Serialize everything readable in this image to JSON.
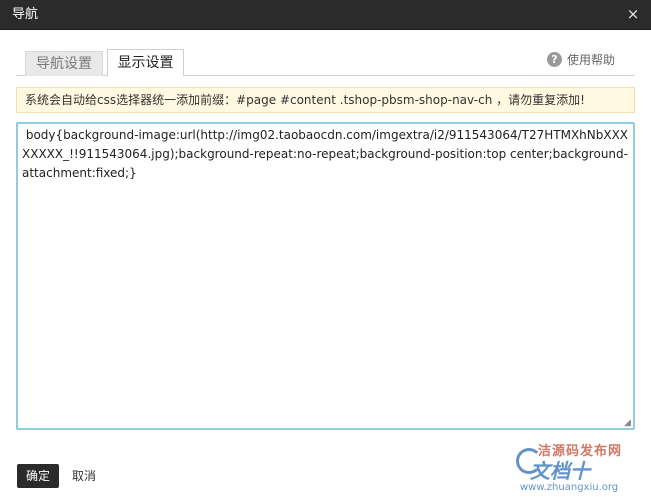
{
  "dialog": {
    "title": "导航",
    "close_glyph": "×"
  },
  "tabs": [
    {
      "label": "导航设置",
      "active": false
    },
    {
      "label": "显示设置",
      "active": true
    }
  ],
  "help": {
    "icon_glyph": "?",
    "label": "使用帮助"
  },
  "notice": {
    "text": "系统会自动给css选择器统一添加前缀：#page #content .tshop-pbsm-shop-nav-ch ，请勿重复添加!"
  },
  "editor": {
    "value": " body{background-image:url(http://img02.taobaocdn.com/imgextra/i2/911543064/T27HTMXhNbXXXXXXXX_!!911543064.jpg);background-repeat:no-repeat;background-position:top center;background-attachment:fixed;}"
  },
  "buttons": {
    "confirm": "确定",
    "cancel": "取消"
  },
  "watermark": {
    "top": "洁源码发布网",
    "big": "文档十",
    "url": "www.zhuangxiu.org"
  },
  "colors": {
    "titlebar": "#2b2b2b",
    "editor_border": "#8fcde0",
    "notice_bg": "#fff9e1"
  }
}
